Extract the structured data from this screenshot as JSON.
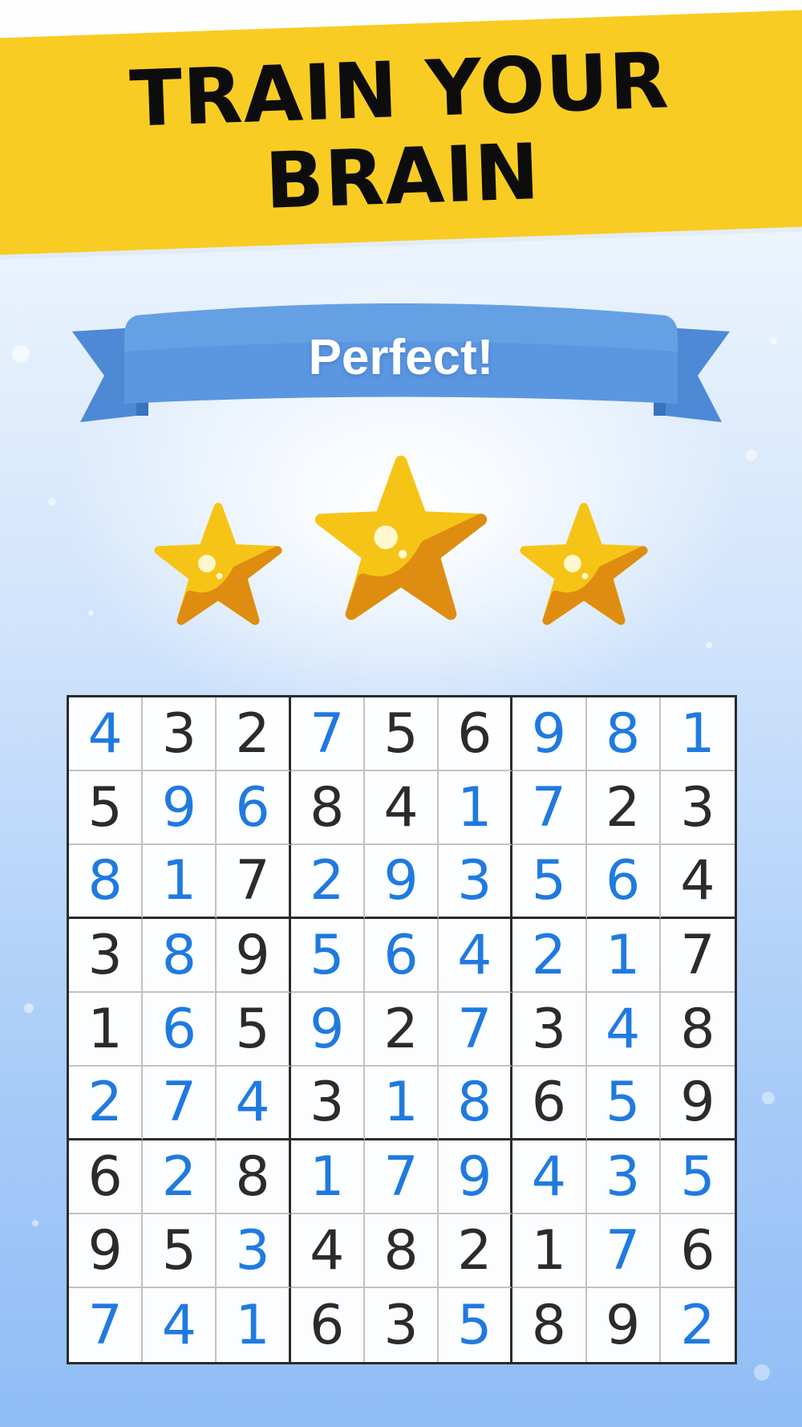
{
  "header": {
    "title_line1": "TRAIN YOUR",
    "title_line2": "BRAIN"
  },
  "ribbon": {
    "label": "Perfect!"
  },
  "rating": {
    "stars_earned": 3,
    "stars_total": 3
  },
  "colors": {
    "banner": "#f9cc23",
    "ribbon": "#5b97e0",
    "star": "#f6c417",
    "given_digit": "#2b2b2b",
    "user_digit": "#1f7ae0"
  },
  "sudoku": {
    "rows": [
      [
        "4",
        "3",
        "2",
        "7",
        "5",
        "6",
        "9",
        "8",
        "1"
      ],
      [
        "5",
        "9",
        "6",
        "8",
        "4",
        "1",
        "7",
        "2",
        "3"
      ],
      [
        "8",
        "1",
        "7",
        "2",
        "9",
        "3",
        "5",
        "6",
        "4"
      ],
      [
        "3",
        "8",
        "9",
        "5",
        "6",
        "4",
        "2",
        "1",
        "7"
      ],
      [
        "1",
        "6",
        "5",
        "9",
        "2",
        "7",
        "3",
        "4",
        "8"
      ],
      [
        "2",
        "7",
        "4",
        "3",
        "1",
        "8",
        "6",
        "5",
        "9"
      ],
      [
        "6",
        "2",
        "8",
        "1",
        "7",
        "9",
        "4",
        "3",
        "5"
      ],
      [
        "9",
        "5",
        "3",
        "4",
        "8",
        "2",
        "1",
        "7",
        "6"
      ],
      [
        "7",
        "4",
        "1",
        "6",
        "3",
        "5",
        "8",
        "9",
        "2"
      ]
    ],
    "user_filled": [
      [
        1,
        0,
        0,
        1,
        0,
        0,
        1,
        1,
        1
      ],
      [
        0,
        1,
        1,
        0,
        0,
        1,
        1,
        0,
        0
      ],
      [
        1,
        1,
        0,
        1,
        1,
        1,
        1,
        1,
        0
      ],
      [
        0,
        1,
        0,
        1,
        1,
        1,
        1,
        1,
        0
      ],
      [
        0,
        1,
        0,
        1,
        0,
        1,
        0,
        1,
        0
      ],
      [
        1,
        1,
        1,
        0,
        1,
        1,
        0,
        1,
        0
      ],
      [
        0,
        1,
        0,
        1,
        1,
        1,
        1,
        1,
        1
      ],
      [
        0,
        0,
        1,
        0,
        0,
        0,
        0,
        1,
        0
      ],
      [
        1,
        1,
        1,
        0,
        0,
        1,
        0,
        0,
        1
      ]
    ]
  }
}
